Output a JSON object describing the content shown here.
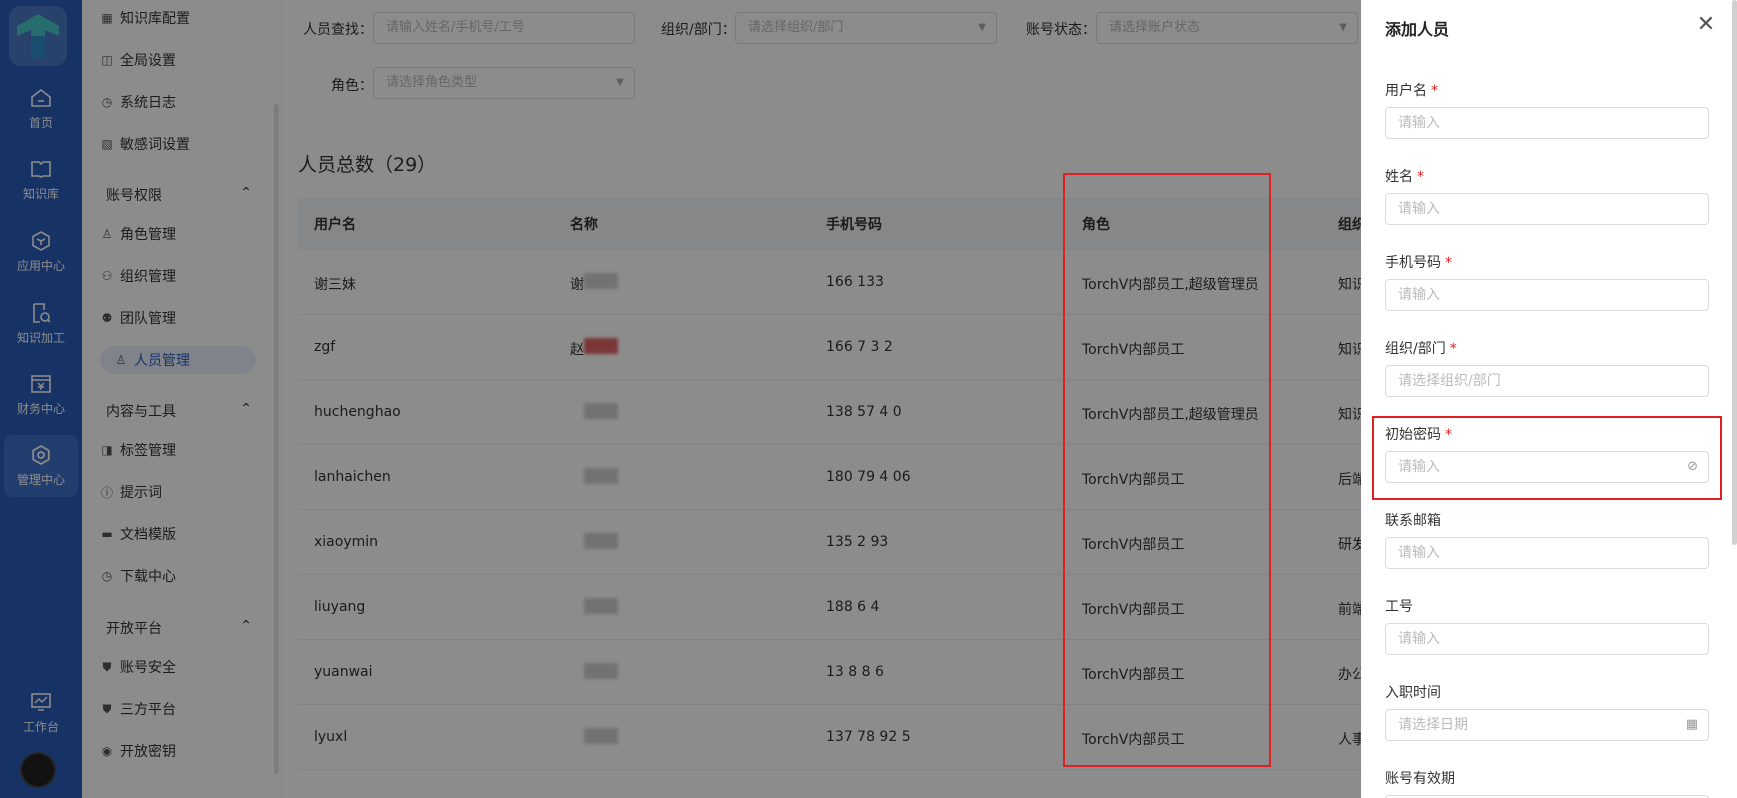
{
  "rail": {
    "items": [
      {
        "label": "首页",
        "icon": "home-icon"
      },
      {
        "label": "知识库",
        "icon": "book-icon"
      },
      {
        "label": "应用中心",
        "icon": "cube-icon"
      },
      {
        "label": "知识加工",
        "icon": "doc-process-icon"
      },
      {
        "label": "财务中心",
        "icon": "finance-icon"
      },
      {
        "label": "管理中心",
        "icon": "gear-icon"
      }
    ],
    "bottom": {
      "label": "工作台",
      "icon": "monitor-icon"
    }
  },
  "menu": {
    "top_items": [
      "知识库配置",
      "全局设置",
      "系统日志",
      "敏感词设置"
    ],
    "groups": [
      {
        "title": "账号权限",
        "items": [
          "角色管理",
          "组织管理",
          "团队管理",
          "人员管理"
        ]
      },
      {
        "title": "内容与工具",
        "items": [
          "标签管理",
          "提示词",
          "文档模版",
          "下载中心"
        ]
      },
      {
        "title": "开放平台",
        "items": [
          "账号安全",
          "三方平台",
          "开放密钥"
        ]
      }
    ]
  },
  "filters": {
    "search_label": "人员查找：",
    "search_placeholder": "请输入姓名/手机号/工号",
    "org_label": "组织/部门：",
    "org_placeholder": "请选择组织/部门",
    "status_label": "账号状态：",
    "status_placeholder": "请选择账户状态",
    "role_label": "角色：",
    "role_placeholder": "请选择角色类型"
  },
  "total_label": "人员总数（29）",
  "table": {
    "headers": [
      "用户名",
      "名称",
      "手机号码",
      "角色",
      "组织"
    ],
    "rows": [
      {
        "username": "谢三妹",
        "name": "谢",
        "phone": "166 133",
        "role": "TorchV内部员工,超级管理员",
        "org": "知识"
      },
      {
        "username": "zgf",
        "name": "赵",
        "phone": "166 7 3 2",
        "role": "TorchV内部员工",
        "org": "知识"
      },
      {
        "username": "huchenghao",
        "name": "",
        "phone": "138 57 4 0",
        "role": "TorchV内部员工,超级管理员",
        "org": "知识"
      },
      {
        "username": "lanhaichen",
        "name": "",
        "phone": "180 79 4 06",
        "role": "TorchV内部员工",
        "org": "后端"
      },
      {
        "username": "xiaoymin",
        "name": "",
        "phone": "135 2 93",
        "role": "TorchV内部员工",
        "org": "研发"
      },
      {
        "username": "liuyang",
        "name": "",
        "phone": "188 6 4",
        "role": "TorchV内部员工",
        "org": "前端"
      },
      {
        "username": "yuanwai",
        "name": "",
        "phone": "13 8 8 6",
        "role": "TorchV内部员工",
        "org": "办公"
      },
      {
        "username": "lyuxl",
        "name": "",
        "phone": "137 78 92 5",
        "role": "TorchV内部员工",
        "org": "人事"
      }
    ]
  },
  "drawer": {
    "title": "添加人员",
    "fields": [
      {
        "label": "用户名",
        "required": "*",
        "placeholder": "请输入"
      },
      {
        "label": "姓名",
        "required": "*",
        "placeholder": "请输入"
      },
      {
        "label": "手机号码",
        "required": "*",
        "placeholder": "请输入"
      },
      {
        "label": "组织/部门",
        "required": "*",
        "placeholder": "请选择组织/部门"
      },
      {
        "label": "初始密码",
        "required": "*",
        "placeholder": "请输入"
      },
      {
        "label": "联系邮箱",
        "required": "",
        "placeholder": "请输入"
      },
      {
        "label": "工号",
        "required": "",
        "placeholder": "请输入"
      },
      {
        "label": "入职时间",
        "required": "",
        "placeholder": "请选择日期"
      },
      {
        "label": "账号有效期",
        "required": "",
        "placeholder": ""
      }
    ]
  },
  "colors": {
    "brand": "#2a5db8",
    "highlight": "#e02020"
  }
}
